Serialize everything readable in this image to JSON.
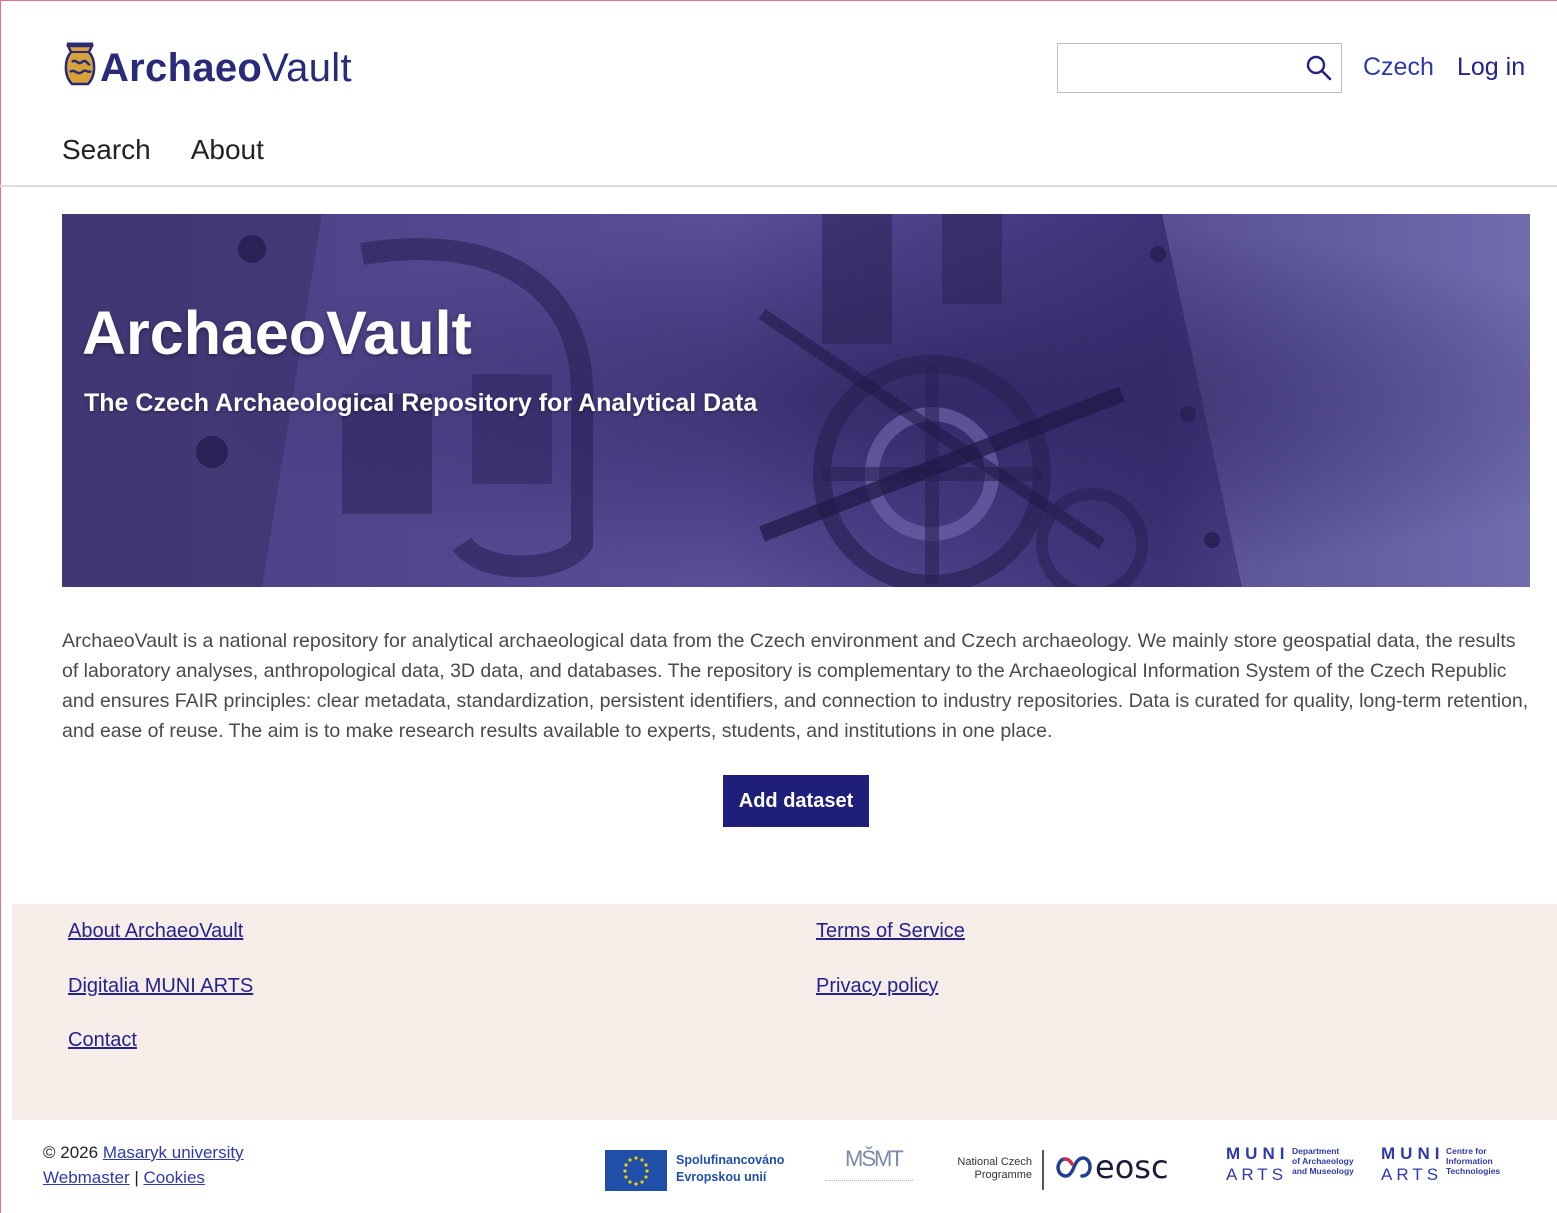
{
  "header": {
    "logo_bold": "Archaeo",
    "logo_light": "Vault",
    "search": {
      "value": "",
      "placeholder": ""
    },
    "language_link": "Czech",
    "login_link": "Log in",
    "nav": [
      "Search",
      "About"
    ]
  },
  "hero": {
    "title": "ArchaeoVault",
    "subtitle": "The Czech Archaeological Repository for Analytical Data"
  },
  "description": "ArchaeoVault is a national repository for analytical archaeological data from the Czech environment and Czech archaeology. We mainly store geospatial data, the results of laboratory analyses, anthropological data, 3D data, and databases. The repository is complementary to the Archaeological Information System of the Czech Republic and ensures FAIR principles: clear metadata, standardization, persistent identifiers, and connection to industry repositories. Data is curated for quality, long-term retention, and ease of reuse. The aim is to make research results available to experts, students, and institutions in one place.",
  "add_dataset_label": "Add dataset",
  "footer": {
    "col1": [
      "About ArchaeoVault",
      "Digitalia MUNI ARTS",
      "Contact"
    ],
    "col2": [
      "Terms of Service",
      "Privacy policy"
    ],
    "copyright_prefix": "© 2026",
    "university": "Masaryk university",
    "webmaster": "Webmaster",
    "separator": "|",
    "cookies": "Cookies"
  },
  "partners": {
    "eu_line1": "Spolufinancováno",
    "eu_line2": "Evropskou unií",
    "msmt": "MŠMT",
    "ncp_line1": "National Czech",
    "ncp_line2": "Programme",
    "eosc": "eosc",
    "muni1": {
      "top": "MUNI",
      "bottom": "ARTS",
      "l1": "Department",
      "l2": "of Archaeology",
      "l3": "and Museology"
    },
    "muni2": {
      "top": "MUNI",
      "bottom": "ARTS",
      "l1": "Centre for",
      "l2": "Information",
      "l3": "Technologies"
    }
  },
  "colors": {
    "brand": "#23238a",
    "link": "#2f3aa8",
    "footer_bg": "#f7ede8",
    "button": "#1f1f7a"
  }
}
